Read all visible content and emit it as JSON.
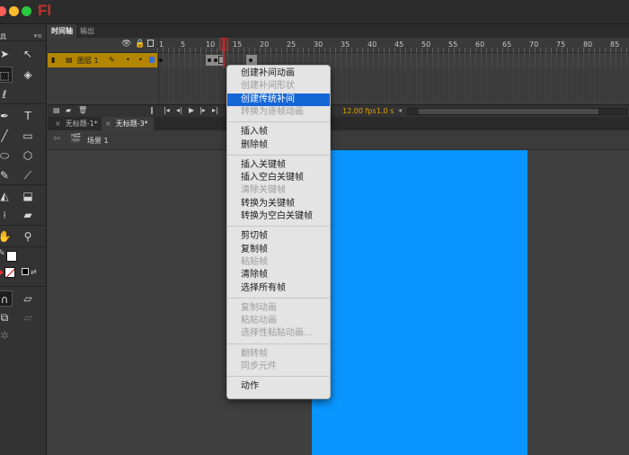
{
  "app": {
    "logo": "Fl"
  },
  "colors": {
    "stage": "#0a95ff",
    "layer_highlight": "#b28600",
    "playhead": "#c0282a",
    "menu_highlight": "#1466d6"
  },
  "toolbar": {
    "header_label": "具",
    "icons": [
      "selection-arrow-icon",
      "subselection-arrow-icon",
      "free-transform-icon",
      "3d-rotation-icon",
      "lasso-icon",
      "pen-icon",
      "text-icon",
      "line-icon",
      "rectangle-icon",
      "oval-icon",
      "polystar-icon",
      "pencil-icon",
      "brush-icon",
      "paint-bucket-icon",
      "ink-bottle-icon",
      "eyedropper-icon",
      "eraser-icon",
      "hand-icon",
      "zoom-icon"
    ]
  },
  "timeline": {
    "tabs": [
      "时间轴",
      "输出"
    ],
    "frame_numbers": [
      "1",
      "5",
      "10",
      "15",
      "20",
      "25",
      "30",
      "35",
      "40",
      "45",
      "50",
      "55",
      "60",
      "65",
      "70",
      "75",
      "80",
      "85"
    ],
    "layer": {
      "name": "图层 1"
    },
    "fps": "12.00 fps",
    "elapsed": "1.0 s"
  },
  "documents": {
    "tabs": [
      "无标题-1*",
      "无标题-3*"
    ],
    "active_index": 1,
    "scene": "场景 1"
  },
  "context_menu": {
    "groups": [
      [
        {
          "label": "创建补间动画",
          "enabled": true
        },
        {
          "label": "创建补间形状",
          "enabled": false
        },
        {
          "label": "创建传统补间",
          "enabled": true,
          "highlighted": true
        },
        {
          "label": "转换为逐帧动画",
          "enabled": false
        }
      ],
      [
        {
          "label": "插入帧",
          "enabled": true
        },
        {
          "label": "删除帧",
          "enabled": true
        }
      ],
      [
        {
          "label": "插入关键帧",
          "enabled": true
        },
        {
          "label": "插入空白关键帧",
          "enabled": true
        },
        {
          "label": "清除关键帧",
          "enabled": false
        },
        {
          "label": "转换为关键帧",
          "enabled": true
        },
        {
          "label": "转换为空白关键帧",
          "enabled": true
        }
      ],
      [
        {
          "label": "剪切帧",
          "enabled": true
        },
        {
          "label": "复制帧",
          "enabled": true
        },
        {
          "label": "粘贴帧",
          "enabled": false
        },
        {
          "label": "清除帧",
          "enabled": true
        },
        {
          "label": "选择所有帧",
          "enabled": true
        }
      ],
      [
        {
          "label": "复制动画",
          "enabled": false
        },
        {
          "label": "粘贴动画",
          "enabled": false
        },
        {
          "label": "选择性粘贴动画...",
          "enabled": false
        }
      ],
      [
        {
          "label": "翻转帧",
          "enabled": false
        },
        {
          "label": "同步元件",
          "enabled": false
        }
      ],
      [
        {
          "label": "动作",
          "enabled": true
        }
      ]
    ]
  }
}
